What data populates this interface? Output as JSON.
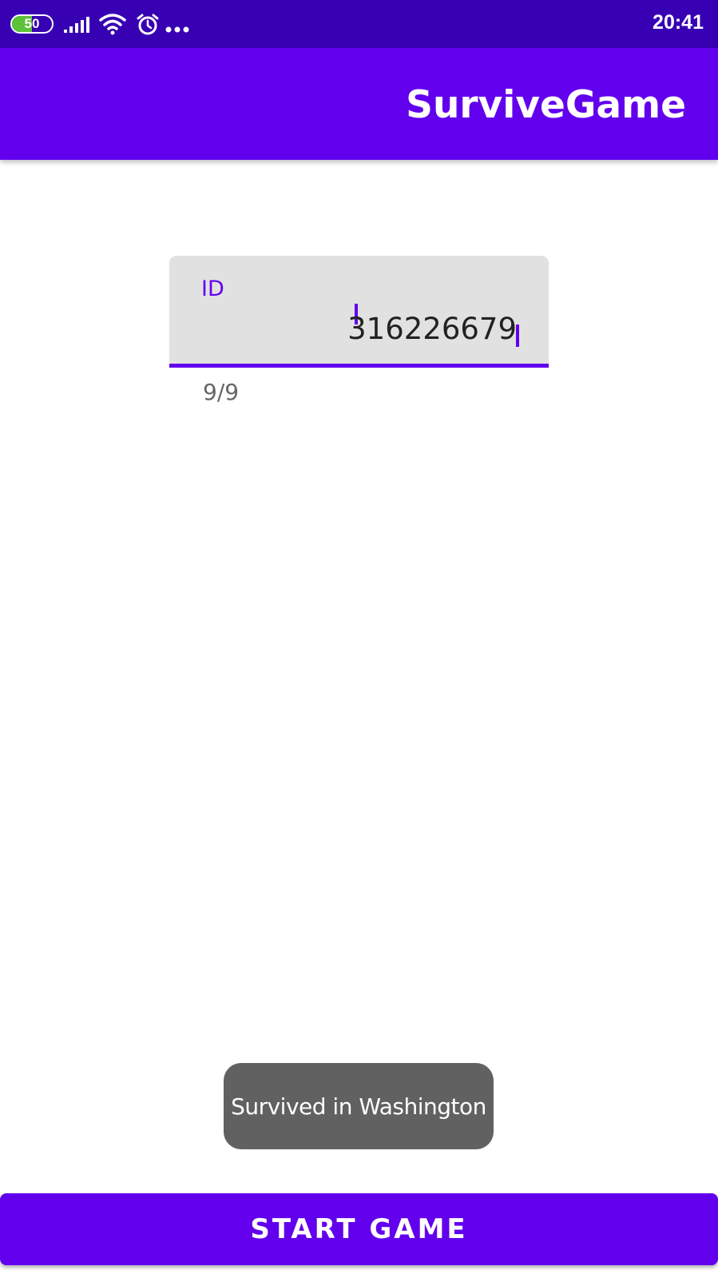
{
  "status_bar": {
    "battery_level": "50",
    "battery_fraction": 0.5,
    "time": "20:41",
    "icons": [
      "signal-icon",
      "wifi-icon",
      "alarm-icon",
      "more-notifications-icon"
    ]
  },
  "app_bar": {
    "title": "SurviveGame"
  },
  "id_field": {
    "label": "ID",
    "value": "316226679",
    "counter": "9/9"
  },
  "toast": {
    "message": "Survived in Washington"
  },
  "start_button": {
    "label": "START GAME"
  },
  "colors": {
    "primary": "#6200ee",
    "primary_dark": "#3700b3",
    "field_background": "#e1e1e1",
    "toast_background": "#616161"
  }
}
